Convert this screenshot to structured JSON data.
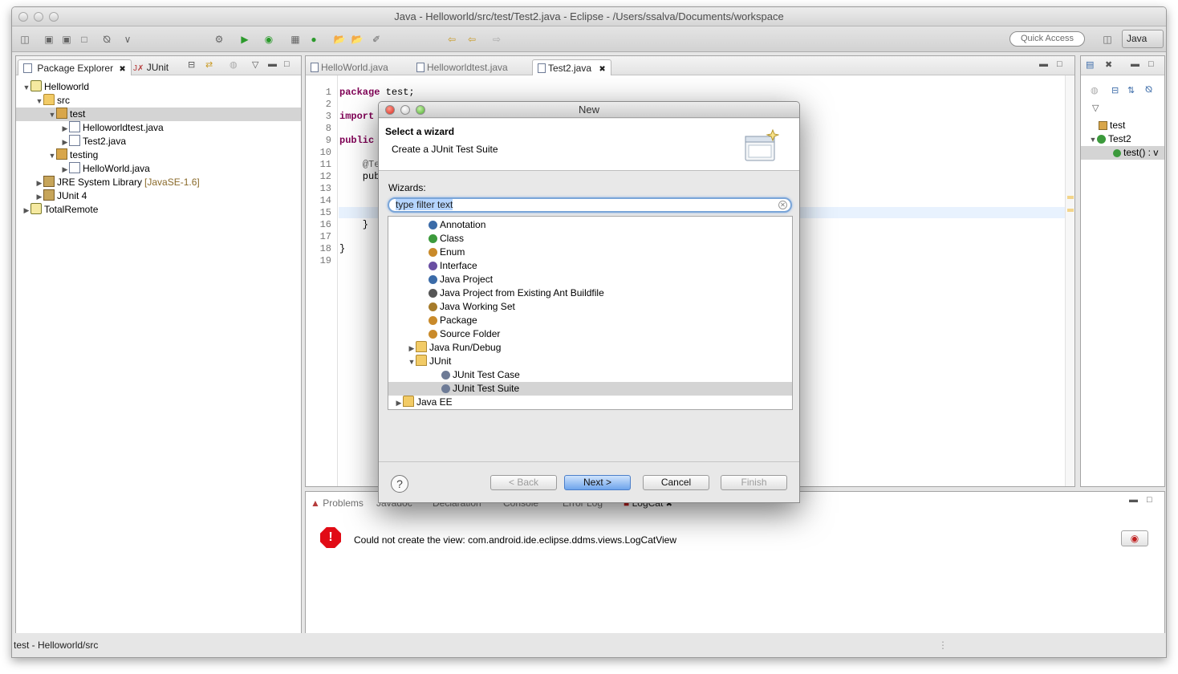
{
  "window": {
    "title": "Java - Helloworld/src/test/Test2.java - Eclipse - /Users/ssalva/Documents/workspace"
  },
  "toolbar": {
    "quick_access": "Quick Access",
    "perspective": "Java"
  },
  "package_explorer": {
    "tabs": [
      "Package Explorer",
      "JUnit"
    ],
    "tree": [
      {
        "label": "Helloworld",
        "level": 0,
        "expanded": true,
        "icon": "project-icon"
      },
      {
        "label": "src",
        "level": 1,
        "expanded": true,
        "icon": "source-folder-icon"
      },
      {
        "label": "test",
        "level": 2,
        "expanded": true,
        "icon": "package-icon",
        "selected": true
      },
      {
        "label": "Helloworldtest.java",
        "level": 3,
        "expanded": false,
        "icon": "java-file-icon"
      },
      {
        "label": "Test2.java",
        "level": 3,
        "expanded": false,
        "icon": "java-file-icon"
      },
      {
        "label": "testing",
        "level": 2,
        "expanded": true,
        "icon": "package-icon"
      },
      {
        "label": "HelloWorld.java",
        "level": 3,
        "expanded": false,
        "icon": "java-file-icon"
      },
      {
        "label": "JRE System Library",
        "decoration": "[JavaSE-1.6]",
        "level": 1,
        "expanded": false,
        "icon": "library-icon"
      },
      {
        "label": "JUnit 4",
        "level": 1,
        "expanded": false,
        "icon": "library-icon"
      },
      {
        "label": "TotalRemote",
        "level": 0,
        "expanded": false,
        "icon": "project-icon"
      }
    ]
  },
  "editor": {
    "tabs": [
      "HelloWorld.java",
      "Helloworldtest.java",
      "Test2.java"
    ],
    "active_tab": "Test2.java",
    "lines": [
      {
        "n": "1",
        "code": "package test;"
      },
      {
        "n": "2",
        "code": ""
      },
      {
        "n": "3",
        "code": "import s"
      },
      {
        "n": "8",
        "code": ""
      },
      {
        "n": "9",
        "code": "public c"
      },
      {
        "n": "10",
        "code": ""
      },
      {
        "n": "11",
        "code": "    @Tes"
      },
      {
        "n": "12",
        "code": "    publ"
      },
      {
        "n": "13",
        "code": ""
      },
      {
        "n": "14",
        "code": ""
      },
      {
        "n": "15",
        "code": ""
      },
      {
        "n": "16",
        "code": "    }"
      },
      {
        "n": "17",
        "code": ""
      },
      {
        "n": "18",
        "code": "}"
      },
      {
        "n": "19",
        "code": ""
      }
    ]
  },
  "outline": {
    "items": [
      {
        "label": "test",
        "icon": "package-icon"
      },
      {
        "label": "Test2",
        "icon": "class-icon"
      },
      {
        "label": "test() : v",
        "icon": "method-icon"
      }
    ]
  },
  "bottom_panel": {
    "tabs": [
      "Problems",
      "Javadoc",
      "Declaration",
      "Console",
      "Error Log",
      "LogCat"
    ],
    "error_message": "Could not create the view: com.android.ide.eclipse.ddms.views.LogCatView"
  },
  "status_bar": {
    "text": "test - Helloworld/src"
  },
  "dialog": {
    "title": "New",
    "heading": "Select a wizard",
    "description": "Create a JUnit Test Suite",
    "wizards_label": "Wizards:",
    "filter_text": "type filter text",
    "items": [
      {
        "label": "Annotation",
        "icon": "annotation-icon",
        "level": 2
      },
      {
        "label": "Class",
        "icon": "class-icon",
        "level": 2
      },
      {
        "label": "Enum",
        "icon": "enum-icon",
        "level": 2
      },
      {
        "label": "Interface",
        "icon": "interface-icon",
        "level": 2
      },
      {
        "label": "Java Project",
        "icon": "java-project-icon",
        "level": 2
      },
      {
        "label": "Java Project from Existing Ant Buildfile",
        "icon": "ant-icon",
        "level": 2
      },
      {
        "label": "Java Working Set",
        "icon": "working-set-icon",
        "level": 2
      },
      {
        "label": "Package",
        "icon": "package-icon",
        "level": 2
      },
      {
        "label": "Source Folder",
        "icon": "source-folder-icon",
        "level": 2
      },
      {
        "label": "Java Run/Debug",
        "icon": "folder-icon",
        "level": 1,
        "expander": "collapsed"
      },
      {
        "label": "JUnit",
        "icon": "folder-icon",
        "level": 1,
        "expander": "expanded"
      },
      {
        "label": "JUnit Test Case",
        "icon": "junit-case-icon",
        "level": 3
      },
      {
        "label": "JUnit Test Suite",
        "icon": "junit-suite-icon",
        "level": 3,
        "selected": true
      },
      {
        "label": "Java EE",
        "icon": "folder-icon",
        "level": 0,
        "expander": "collapsed"
      }
    ],
    "buttons": {
      "back": "< Back",
      "next": "Next >",
      "cancel": "Cancel",
      "finish": "Finish"
    }
  }
}
